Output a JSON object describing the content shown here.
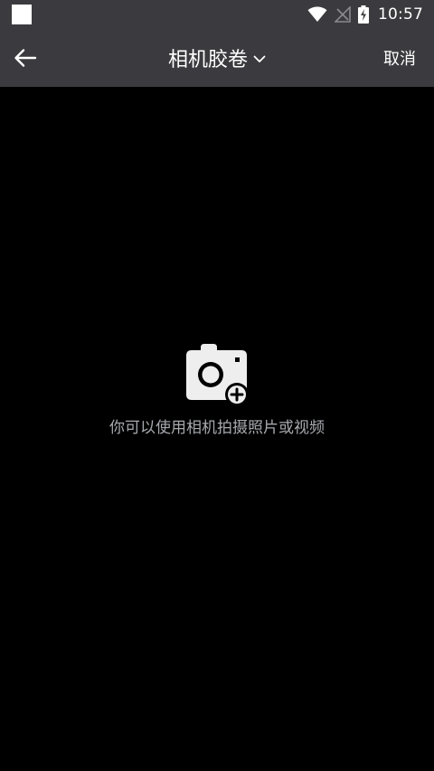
{
  "status_bar": {
    "time": "10:57"
  },
  "toolbar": {
    "title": "相机胶卷",
    "cancel_label": "取消"
  },
  "empty_state": {
    "message": "你可以使用相机拍摄照片或视频"
  },
  "icons": {
    "back": "arrow-left-icon",
    "title_dropdown": "chevron-down-icon",
    "camera_add": "camera-plus-icon",
    "wifi": "wifi-icon",
    "signal": "no-signal-icon",
    "battery": "battery-charging-icon",
    "notification": "notification-square-icon"
  },
  "colors": {
    "bar_background": "#3b3b3f",
    "content_background": "#000000",
    "text_primary": "#ffffff",
    "text_secondary": "#a6a9ae"
  }
}
